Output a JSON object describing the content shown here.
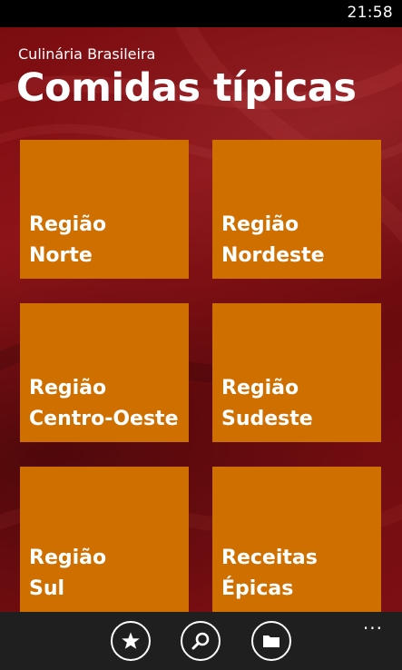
{
  "status_bar": {
    "time": "21:58"
  },
  "header": {
    "app_name": "Culinária Brasileira",
    "page_title": "Comidas típicas"
  },
  "tiles": [
    {
      "line1": "Região",
      "line2": "Norte"
    },
    {
      "line1": "Região",
      "line2": "Nordeste"
    },
    {
      "line1": "Região",
      "line2": "Centro-Oeste"
    },
    {
      "line1": "Região",
      "line2": "Sudeste"
    },
    {
      "line1": "Região",
      "line2": "Sul"
    },
    {
      "line1": "Receitas",
      "line2": "Épicas"
    }
  ],
  "app_bar": {
    "buttons": [
      {
        "icon": "star-icon"
      },
      {
        "icon": "search-icon"
      },
      {
        "icon": "folder-icon"
      }
    ],
    "more_label": "..."
  },
  "colors": {
    "tile": "#ce6f00",
    "background": "#7a0c10",
    "app_bar": "#1f1f1f"
  }
}
